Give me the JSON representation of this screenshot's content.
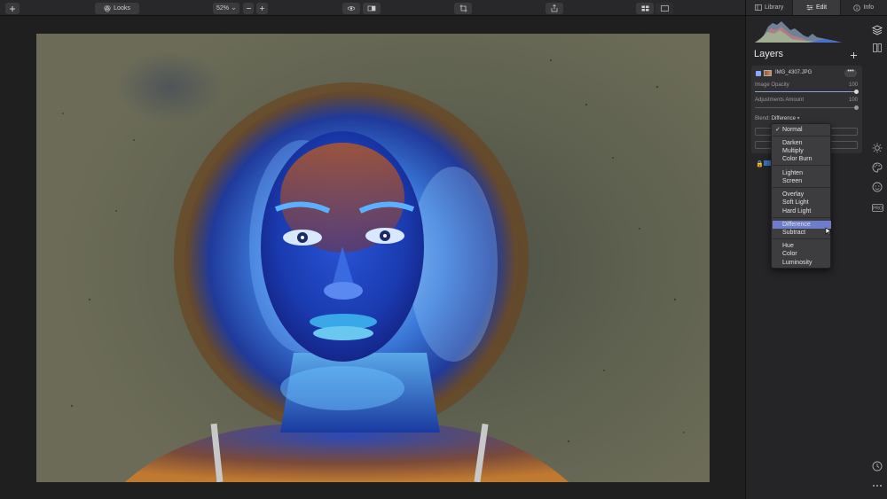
{
  "toolbar": {
    "looks_label": "Looks",
    "zoom_value": "52%"
  },
  "panel_tabs": [
    {
      "label": "Library",
      "icon": "library-icon"
    },
    {
      "label": "Edit",
      "icon": "sliders-icon"
    },
    {
      "label": "Info",
      "icon": "info-icon"
    }
  ],
  "layers": {
    "title": "Layers",
    "layer1": {
      "name": "IMG_4307.JPG",
      "more": "•••",
      "image_opacity_label": "Image Opacity",
      "image_opacity_value": "100",
      "adjustments_label": "Adjustments Amount",
      "adjustments_value": "100",
      "blend_label": "Blend:",
      "blend_value": "Difference"
    }
  },
  "blend_menu": {
    "groups": [
      [
        "Normal"
      ],
      [
        "Darken",
        "Multiply",
        "Color Burn"
      ],
      [
        "Lighten",
        "Screen"
      ],
      [
        "Overlay",
        "Soft Light",
        "Hard Light"
      ],
      [
        "Difference",
        "Subtract"
      ],
      [
        "Hue",
        "Color",
        "Luminosity"
      ]
    ],
    "checked": "Normal",
    "highlighted": "Difference",
    "items": {
      "normal": "Normal",
      "darken": "Darken",
      "multiply": "Multiply",
      "color_burn": "Color Burn",
      "lighten": "Lighten",
      "screen": "Screen",
      "overlay": "Overlay",
      "soft_light": "Soft Light",
      "hard_light": "Hard Light",
      "difference": "Difference",
      "subtract": "Subtract",
      "hue": "Hue",
      "color": "Color",
      "luminosity": "Luminosity"
    },
    "check_mark": "✓"
  },
  "colors": {
    "accent": "#6e7dc9",
    "panel": "#252527"
  }
}
